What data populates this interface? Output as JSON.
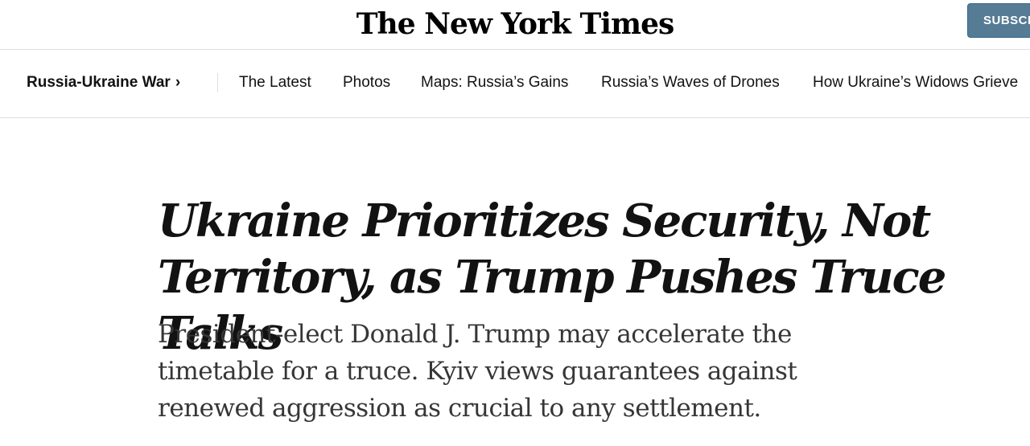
{
  "masthead": {
    "logo_text": "The New York Times",
    "subscribe_label": "SUBSCRIBE"
  },
  "nav": {
    "section_label": "Russia-Ukraine War",
    "section_chevron": "›",
    "links": [
      "The Latest",
      "Photos",
      "Maps: Russia’s Gains",
      "Russia’s Waves of Drones",
      "How Ukraine’s Widows Grieve"
    ]
  },
  "article": {
    "headline": "Ukraine Prioritizes Security, Not Territory, as Trump Pushes Truce Talks",
    "summary": "President-elect Donald J. Trump may accelerate the timetable for a truce. Kyiv views guarantees against renewed aggression as crucial to any settlement."
  },
  "colors": {
    "subscribe_bg": "#567b95",
    "divider": "#dfdfdf",
    "text": "#121212",
    "summary_text": "#363636"
  }
}
